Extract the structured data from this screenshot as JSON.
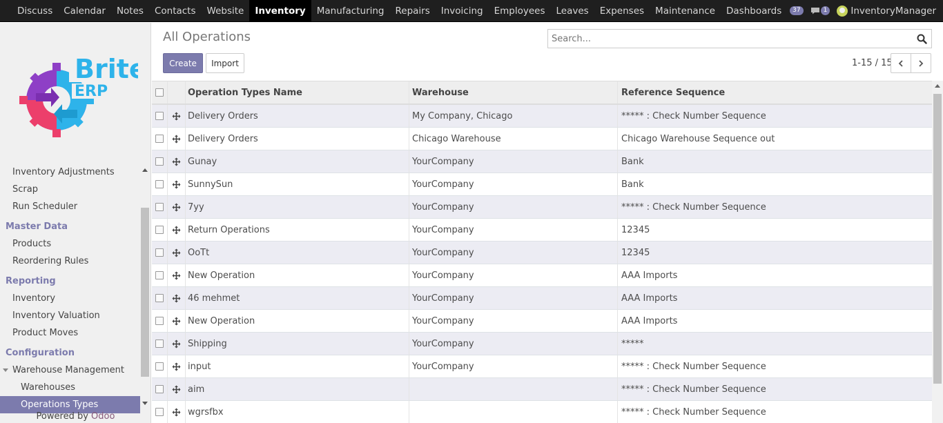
{
  "topnav": {
    "items": [
      "Discuss",
      "Calendar",
      "Notes",
      "Contacts",
      "Website",
      "Inventory",
      "Manufacturing",
      "Repairs",
      "Invoicing",
      "Employees",
      "Leaves",
      "Expenses",
      "Maintenance",
      "Dashboards"
    ],
    "active": "Inventory",
    "activity_count": "37",
    "message_count": "1",
    "user_name": "InventoryManager"
  },
  "logo": {
    "word1": "Brite",
    "word2": "ERP"
  },
  "sidebar": {
    "items": [
      {
        "label": "Inventory Adjustments",
        "type": "item"
      },
      {
        "label": "Scrap",
        "type": "item"
      },
      {
        "label": "Run Scheduler",
        "type": "item"
      },
      {
        "label": "Master Data",
        "type": "head"
      },
      {
        "label": "Products",
        "type": "item"
      },
      {
        "label": "Reordering Rules",
        "type": "item"
      },
      {
        "label": "Reporting",
        "type": "head"
      },
      {
        "label": "Inventory",
        "type": "item"
      },
      {
        "label": "Inventory Valuation",
        "type": "item"
      },
      {
        "label": "Product Moves",
        "type": "item"
      },
      {
        "label": "Configuration",
        "type": "head"
      },
      {
        "label": "Warehouse Management",
        "type": "group"
      },
      {
        "label": "Warehouses",
        "type": "sub"
      },
      {
        "label": "Operations Types",
        "type": "sub-active"
      }
    ],
    "powered_by": "Powered by",
    "powered_brand": "Odoo"
  },
  "control": {
    "title": "All Operations",
    "create_label": "Create",
    "import_label": "Import",
    "search_placeholder": "Search...",
    "pager": "1-15 / 15"
  },
  "table": {
    "headers": [
      "Operation Types Name",
      "Warehouse",
      "Reference Sequence"
    ],
    "rows": [
      [
        "Delivery Orders",
        "My Company, Chicago",
        "***** : Check Number Sequence"
      ],
      [
        "Delivery Orders",
        "Chicago Warehouse",
        "Chicago Warehouse Sequence out"
      ],
      [
        "Gunay",
        "YourCompany",
        "Bank"
      ],
      [
        "SunnySun",
        "YourCompany",
        "Bank"
      ],
      [
        "7yy",
        "YourCompany",
        "***** : Check Number Sequence"
      ],
      [
        "Return Operations",
        "YourCompany",
        "12345"
      ],
      [
        "OoTt",
        "YourCompany",
        "12345"
      ],
      [
        "New Operation",
        "YourCompany",
        "AAA Imports"
      ],
      [
        "46 mehmet",
        "YourCompany",
        "AAA Imports"
      ],
      [
        "New Operation",
        "YourCompany",
        "AAA Imports"
      ],
      [
        "Shipping",
        "YourCompany",
        "*****"
      ],
      [
        "input",
        "YourCompany",
        "***** : Check Number Sequence"
      ],
      [
        "aim",
        "",
        "***** : Check Number Sequence"
      ],
      [
        "wgrsfbx",
        "",
        "***** : Check Number Sequence"
      ]
    ]
  },
  "colors": {
    "accent": "#7c7bad",
    "topbar": "#1f1f1f",
    "odd_row": "#ececf3"
  }
}
